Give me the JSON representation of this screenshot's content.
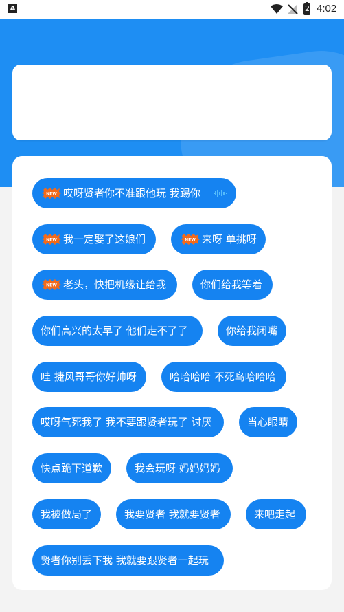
{
  "status_bar": {
    "left_icon": "A",
    "battery_level": "2",
    "time": "4:02",
    "icons": [
      "wifi-icon",
      "no-signal-icon",
      "battery-charging-icon"
    ]
  },
  "colors": {
    "primary": "#1e8ef3",
    "pill": "#1583f1",
    "background": "#f3f3f3",
    "card": "#ffffff",
    "badge": "#f26a1b"
  },
  "new_badge_text": "NEW",
  "phrases": [
    {
      "label": "哎呀贤者你不准跟他玩   我踢你",
      "new": true,
      "wave": true
    },
    {
      "label": "我一定娶了这娘们",
      "new": true
    },
    {
      "label": "来呀 单挑呀",
      "new": true
    },
    {
      "label": "老头，快把机缘让给我",
      "new": true
    },
    {
      "label": "你们给我等着",
      "new": false
    },
    {
      "label": "你们高兴的太早了  他们走不了了",
      "new": false
    },
    {
      "label": "你给我闭嘴",
      "new": false
    },
    {
      "label": "哇 捷风哥哥你好帅呀",
      "new": false
    },
    {
      "label": "哈哈哈哈 不死鸟哈哈哈",
      "new": false
    },
    {
      "label": "哎呀气死我了 我不要跟贤者玩了 讨厌",
      "new": false
    },
    {
      "label": "当心眼睛",
      "new": false
    },
    {
      "label": "快点跪下道歉",
      "new": false
    },
    {
      "label": "我会玩呀  妈妈妈妈",
      "new": false
    },
    {
      "label": "我被做局了",
      "new": false
    },
    {
      "label": "我要贤者 我就要贤者",
      "new": false
    },
    {
      "label": "来吧走起",
      "new": false
    },
    {
      "label": "贤者你别丢下我  我就要跟贤者一起玩",
      "new": false
    }
  ]
}
